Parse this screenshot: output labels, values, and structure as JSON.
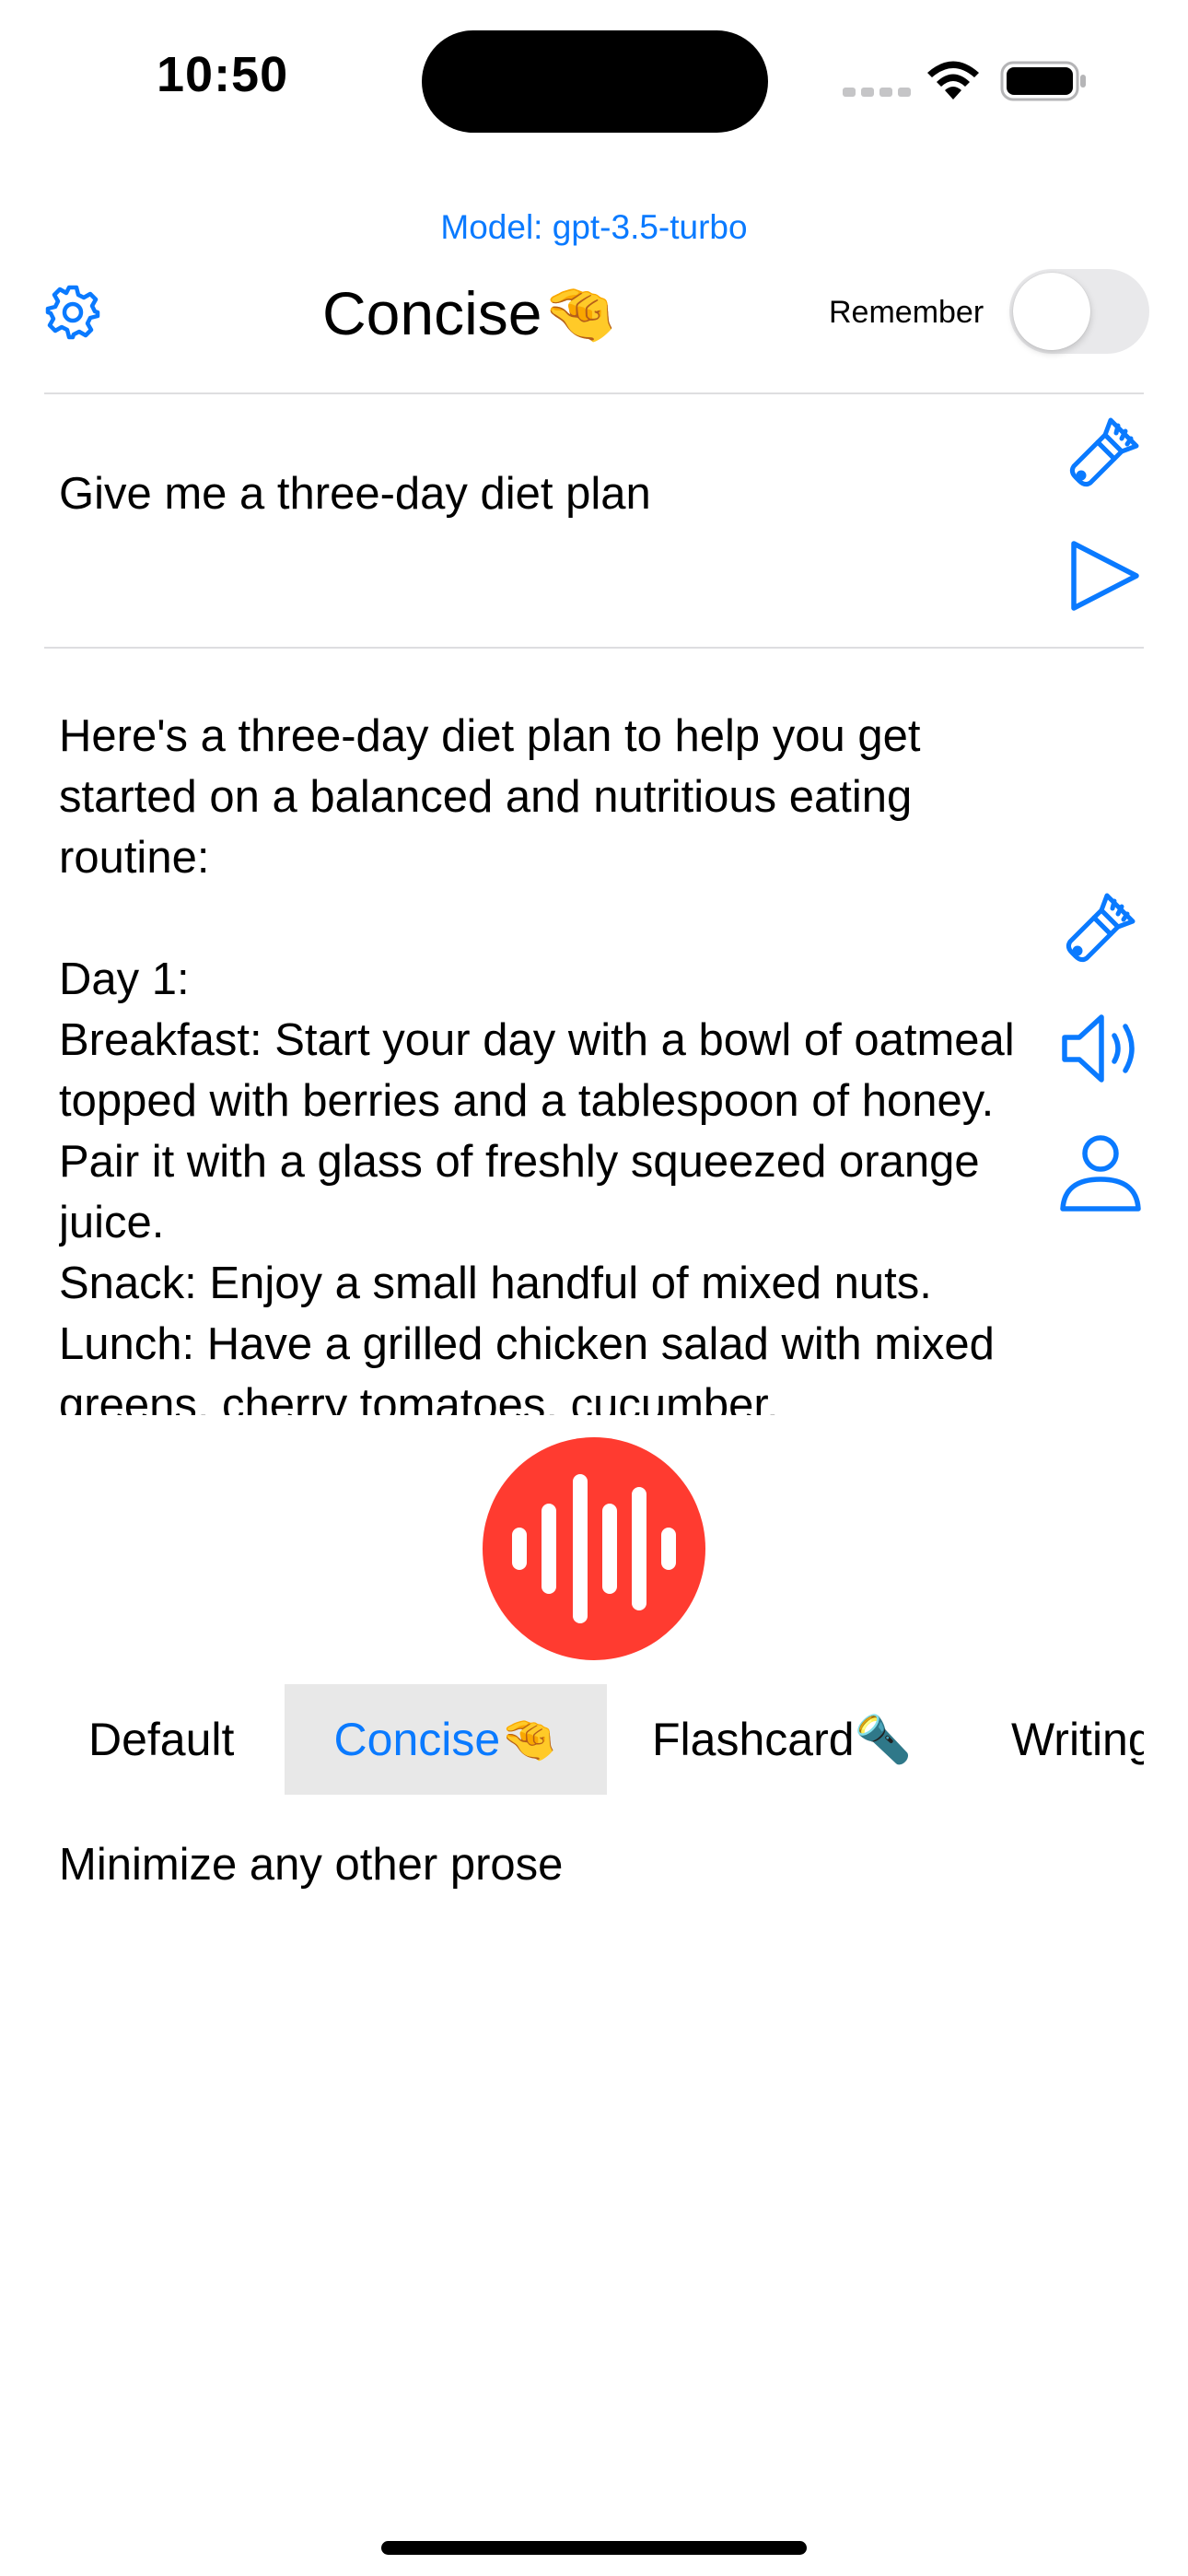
{
  "status_bar": {
    "time": "10:50"
  },
  "header": {
    "model_label": "Model: gpt-3.5-turbo",
    "title": "Concise🤏",
    "remember_label": "Remember",
    "remember_on": false
  },
  "prompt": {
    "text": "Give me a three-day diet plan"
  },
  "response": {
    "text": "Here's a three-day diet plan to help you get started on a balanced and nutritious eating routine:\n\nDay 1:\nBreakfast: Start your day with a bowl of oatmeal topped with berries and a tablespoon of honey. Pair it with a glass of freshly squeezed orange juice.\nSnack: Enjoy a small handful of mixed nuts.\nLunch: Have a grilled chicken salad with mixed greens, cherry tomatoes, cucumber,"
  },
  "tabs": [
    {
      "label": "Default",
      "selected": false
    },
    {
      "label": "Concise🤏",
      "selected": true
    },
    {
      "label": "Flashcard🔦",
      "selected": false
    },
    {
      "label": "Writing",
      "selected": false
    }
  ],
  "system_prompt": {
    "text": "Minimize any other prose"
  },
  "icons": {
    "settings": "gear-icon",
    "clear_prompt": "paintbrush-icon",
    "send": "play-icon",
    "clear_response": "paintbrush-icon",
    "speak": "speaker-icon",
    "profile": "person-icon",
    "record": "waveform-icon"
  },
  "colors": {
    "accent": "#0a7aff",
    "record": "#ff3b30",
    "tab_selected_bg": "#e8e8e8",
    "toggle_off": "#e9e9eb"
  }
}
